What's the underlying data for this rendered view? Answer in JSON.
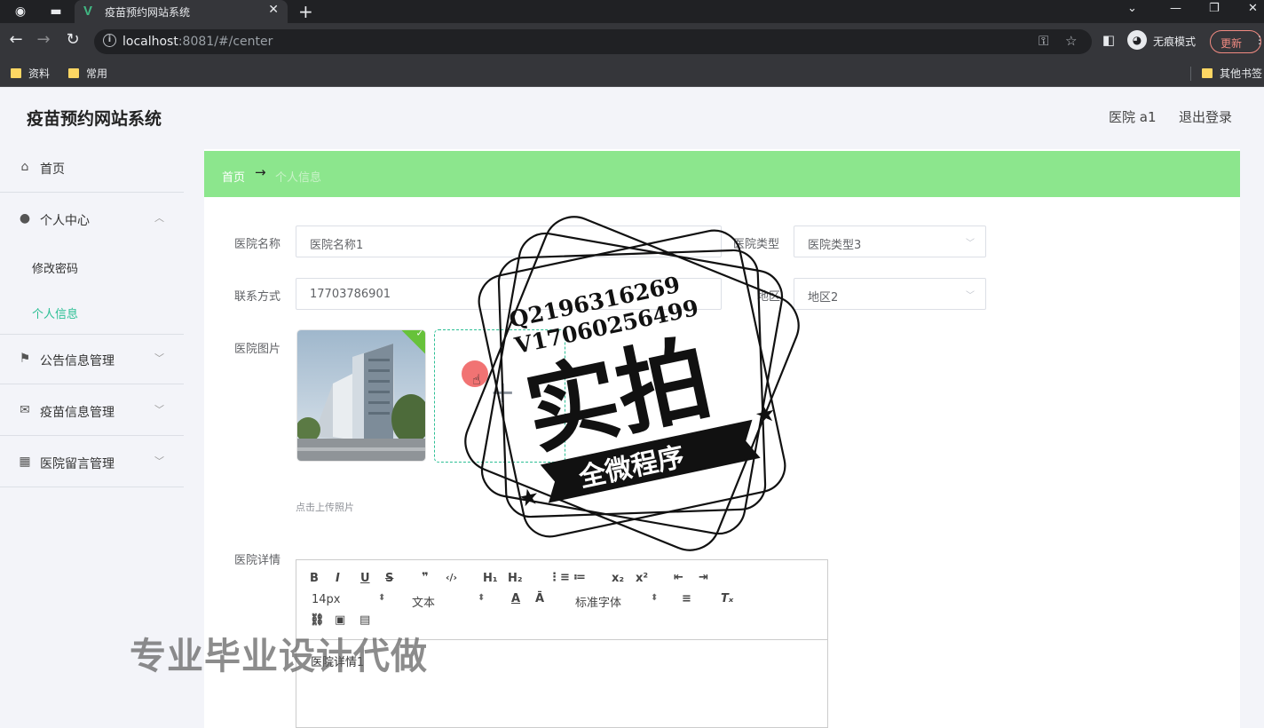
{
  "browser": {
    "tab_title": "疫苗预约网站系统",
    "tab_favicon": "V",
    "url_host": "localhost",
    "url_rest": ":8081/#/center",
    "incognito_label": "无痕模式",
    "update_label": "更新",
    "bookmarks": [
      "资料",
      "常用"
    ],
    "other_bookmarks": "其他书签"
  },
  "app": {
    "title": "疫苗预约网站系统",
    "user": "医院 a1",
    "logout": "退出登录"
  },
  "sidebar": {
    "home": "首页",
    "personal_center": "个人中心",
    "change_password": "修改密码",
    "personal_info": "个人信息",
    "notice_mgmt": "公告信息管理",
    "vaccine_mgmt": "疫苗信息管理",
    "message_mgmt": "医院留言管理"
  },
  "breadcrumb": {
    "home": "首页",
    "arrow": "→",
    "current": "个人信息"
  },
  "form": {
    "name_label": "医院名称",
    "name_value": "医院名称1",
    "type_label": "医院类型",
    "type_value": "医院类型3",
    "contact_label": "联系方式",
    "contact_value": "17703786901",
    "region_label": "地区",
    "region_value": "地区2",
    "image_label": "医院图片",
    "upload_hint": "点击上传照片",
    "detail_label": "医院详情",
    "detail_value": "医院详情1"
  },
  "editor": {
    "font_size": "14px",
    "block_type": "文本",
    "font_family": "标准字体",
    "tools_row1": [
      "B",
      "I",
      "U",
      "S",
      "❞",
      "‹/›",
      "H₁",
      "H₂",
      "⋮≡",
      "≔",
      "x₂",
      "x²",
      "⇤",
      "⇥"
    ],
    "tools_row2_extra": [
      "A",
      "Ā",
      "≡",
      "Tₓ"
    ],
    "tools_row3": [
      "link-icon",
      "image-icon",
      "video-icon"
    ]
  },
  "overlay": {
    "watermark": "专业毕业设计代做",
    "stamp_line1": "Q2196316269",
    "stamp_line2": "V17060256499",
    "stamp_big": "实拍",
    "stamp_banner": "全微程序"
  }
}
